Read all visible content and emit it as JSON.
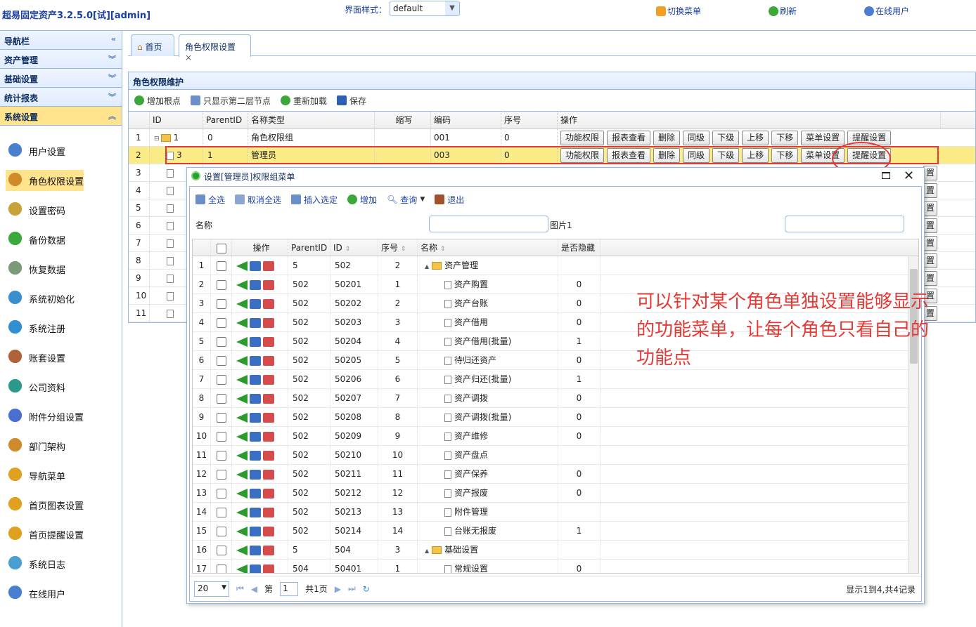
{
  "app": {
    "title": "超易固定资产3.2.5.0[试][admin]",
    "theme_label": "界面样式：",
    "theme_value": "default",
    "links": [
      "切换菜单",
      "刷新",
      "在线用户"
    ]
  },
  "sidebar": {
    "accordions": [
      {
        "label": "导航栏"
      },
      {
        "label": "资产管理"
      },
      {
        "label": "基础设置"
      },
      {
        "label": "统计报表"
      },
      {
        "label": "系统设置"
      }
    ],
    "items": [
      {
        "label": "用户设置"
      },
      {
        "label": "角色权限设置"
      },
      {
        "label": "设置密码"
      },
      {
        "label": "备份数据"
      },
      {
        "label": "恢复数据"
      },
      {
        "label": "系统初始化"
      },
      {
        "label": "系统注册"
      },
      {
        "label": "账套设置"
      },
      {
        "label": "公司资料"
      },
      {
        "label": "附件分组设置"
      },
      {
        "label": "部门架构"
      },
      {
        "label": "导航菜单"
      },
      {
        "label": "首页图表设置"
      },
      {
        "label": "首页提醒设置"
      },
      {
        "label": "系统日志"
      },
      {
        "label": "在线用户"
      }
    ]
  },
  "tabs": {
    "home": "首页",
    "current": "角色权限设置",
    "close": "×"
  },
  "panel": {
    "title": "角色权限维护"
  },
  "toolbar": {
    "add_root": "增加根点",
    "show_second": "只显示第二层节点",
    "reload": "重新加载",
    "save": "保存"
  },
  "grid": {
    "headers": {
      "id": "ID",
      "parent": "ParentID",
      "name": "名称类型",
      "abbr": "缩写",
      "code": "编码",
      "seq": "序号",
      "op": "操作"
    },
    "ops": [
      "功能权限",
      "报表查看",
      "删除",
      "同级",
      "下级",
      "上移",
      "下移",
      "菜单设置",
      "提醒设置"
    ],
    "rows": [
      {
        "n": "1",
        "id": "1",
        "parent": "0",
        "name": "角色权限组",
        "code": "001",
        "seq": "0"
      },
      {
        "n": "2",
        "id": "3",
        "parent": "1",
        "name": "管理员",
        "code": "003",
        "seq": "0"
      },
      {
        "n": "3"
      },
      {
        "n": "4"
      },
      {
        "n": "5"
      },
      {
        "n": "6"
      },
      {
        "n": "7"
      },
      {
        "n": "8"
      },
      {
        "n": "9"
      },
      {
        "n": "10"
      },
      {
        "n": "11"
      }
    ],
    "partial_btn": "置"
  },
  "annotation": "可以针对某个角色单独设置能够显示的功能菜单，让每个角色只看自己的功能点",
  "dialog": {
    "title": "设置[管理员]权限组菜单",
    "toolbar": {
      "select_all": "全选",
      "deselect_all": "取消全选",
      "insert_selected": "插入选定",
      "add": "增加",
      "query": "查询",
      "exit": "退出"
    },
    "search": {
      "name_label": "名称",
      "img_label": "图片1"
    },
    "headers": {
      "op": "操作",
      "parent": "ParentID",
      "id": "ID",
      "seq": "序号",
      "name": "名称",
      "hidden": "是否隐藏"
    },
    "rows": [
      {
        "n": "1",
        "parent": "5",
        "id": "502",
        "seq": "2",
        "name": "资产管理",
        "folder": true,
        "hidden": ""
      },
      {
        "n": "2",
        "parent": "502",
        "id": "50201",
        "seq": "1",
        "name": "资产购置",
        "hidden": "0"
      },
      {
        "n": "3",
        "parent": "502",
        "id": "50202",
        "seq": "2",
        "name": "资产台账",
        "hidden": "0"
      },
      {
        "n": "4",
        "parent": "502",
        "id": "50203",
        "seq": "3",
        "name": "资产借用",
        "hidden": "0"
      },
      {
        "n": "5",
        "parent": "502",
        "id": "50204",
        "seq": "4",
        "name": "资产借用(批量)",
        "hidden": "1"
      },
      {
        "n": "6",
        "parent": "502",
        "id": "50205",
        "seq": "5",
        "name": "待归还资产",
        "hidden": "0"
      },
      {
        "n": "7",
        "parent": "502",
        "id": "50206",
        "seq": "6",
        "name": "资产归还(批量)",
        "hidden": "1"
      },
      {
        "n": "8",
        "parent": "502",
        "id": "50207",
        "seq": "7",
        "name": "资产调拨",
        "hidden": "0"
      },
      {
        "n": "9",
        "parent": "502",
        "id": "50208",
        "seq": "8",
        "name": "资产调拨(批量)",
        "hidden": "0"
      },
      {
        "n": "10",
        "parent": "502",
        "id": "50209",
        "seq": "9",
        "name": "资产维修",
        "hidden": "0"
      },
      {
        "n": "11",
        "parent": "502",
        "id": "50210",
        "seq": "10",
        "name": "资产盘点",
        "hidden": ""
      },
      {
        "n": "12",
        "parent": "502",
        "id": "50211",
        "seq": "11",
        "name": "资产保养",
        "hidden": "0"
      },
      {
        "n": "13",
        "parent": "502",
        "id": "50212",
        "seq": "12",
        "name": "资产报废",
        "hidden": "0"
      },
      {
        "n": "14",
        "parent": "502",
        "id": "50213",
        "seq": "13",
        "name": "附件管理",
        "hidden": ""
      },
      {
        "n": "15",
        "parent": "502",
        "id": "50214",
        "seq": "14",
        "name": "台账无报废",
        "hidden": "1"
      },
      {
        "n": "16",
        "parent": "5",
        "id": "504",
        "seq": "3",
        "name": "基础设置",
        "folder": true,
        "hidden": ""
      },
      {
        "n": "17",
        "parent": "504",
        "id": "50401",
        "seq": "1",
        "name": "常规设置",
        "hidden": "0"
      }
    ],
    "footer": {
      "page_size": "20",
      "page_prefix": "第",
      "page_value": "1",
      "page_total": "共1页",
      "status": "显示1到4,共4记录"
    }
  }
}
